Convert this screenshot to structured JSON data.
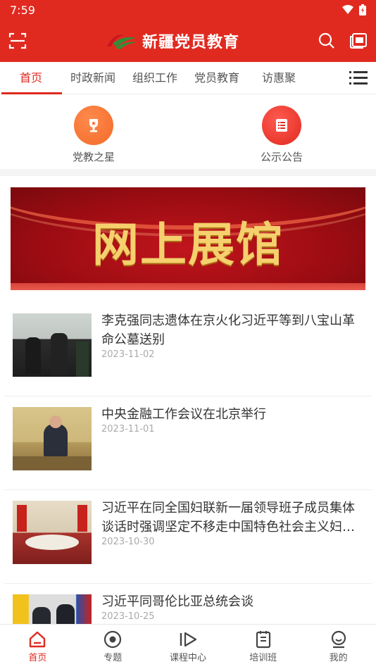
{
  "status_bar": {
    "time": "7:59"
  },
  "header": {
    "title": "新疆党员教育"
  },
  "colors": {
    "brand_red": "#e02a20",
    "orange": "#f26b2a"
  },
  "tabs": [
    {
      "label": "首页",
      "active": true
    },
    {
      "label": "时政新闻"
    },
    {
      "label": "组织工作"
    },
    {
      "label": "党员教育"
    },
    {
      "label": "访惠聚"
    }
  ],
  "quick_entries": [
    {
      "label": "党教之星",
      "icon": "trophy-icon"
    },
    {
      "label": "公示公告",
      "icon": "list-icon"
    }
  ],
  "banner": {
    "text": "网上展馆"
  },
  "news": [
    {
      "title": "李克强同志遗体在京火化习近平等到八宝山革命公墓送别",
      "date": "2023-11-02"
    },
    {
      "title": "中央金融工作会议在北京举行",
      "date": "2023-11-01"
    },
    {
      "title": "习近平在同全国妇联新一届领导班子成员集体谈话时强调坚定不移走中国特色社会主义妇女发展道路",
      "date": "2023-10-30"
    },
    {
      "title": "习近平同哥伦比亚总统会谈",
      "date": "2023-10-25"
    }
  ],
  "bottom_nav": [
    {
      "label": "首页",
      "icon": "home-icon",
      "active": true
    },
    {
      "label": "专题",
      "icon": "topic-icon"
    },
    {
      "label": "课程中心",
      "icon": "play-icon"
    },
    {
      "label": "培训班",
      "icon": "notebook-icon"
    },
    {
      "label": "我的",
      "icon": "profile-icon"
    }
  ]
}
